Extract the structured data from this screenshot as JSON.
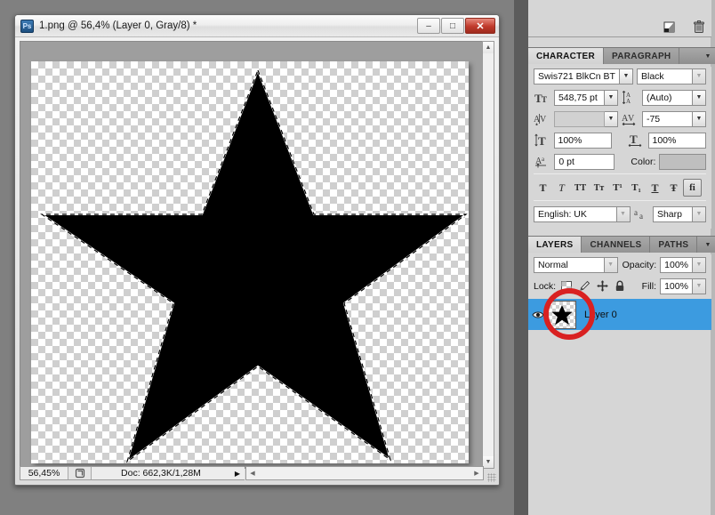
{
  "document_window": {
    "title": "1.png @ 56,4% (Layer 0, Gray/8) *",
    "app_icon": "Ps",
    "window_buttons": [
      {
        "name": "minimize",
        "glyph": "–"
      },
      {
        "name": "maximize",
        "glyph": "□"
      },
      {
        "name": "close",
        "glyph": "✕"
      }
    ],
    "status_bar": {
      "zoom": "56,45%",
      "doc_info": "Doc: 662,3K/1,28M",
      "preview_icon": "page-preview-icon",
      "expand_arrow": "▶"
    },
    "scrollbars": {
      "v_up": "▲",
      "v_down": "▼",
      "h_left": "◀",
      "h_right": "▶"
    }
  },
  "panel_toolstrip": {
    "new_layer_icon": "new-layer-icon",
    "delete_layer_icon": "trash-icon"
  },
  "character_panel": {
    "tabs": [
      {
        "label": "CHARACTER",
        "active": true
      },
      {
        "label": "PARAGRAPH",
        "active": false
      }
    ],
    "menu_arrow": "▼",
    "font_family": "Swis721 BlkCn BT",
    "font_style": "Black",
    "font_size_icon": "font-size-icon",
    "font_size": "548,75 pt",
    "leading_icon": "leading-icon",
    "leading": "(Auto)",
    "kerning_icon": "kerning-icon",
    "kerning": "",
    "tracking_icon": "tracking-icon",
    "tracking": "-75",
    "vertical_scale_icon": "vertical-scale-icon",
    "vertical_scale": "100%",
    "horizontal_scale_icon": "horizontal-scale-icon",
    "horizontal_scale": "100%",
    "baseline_icon": "baseline-shift-icon",
    "baseline_shift": "0 pt",
    "color_label": "Color:",
    "color_value": "#bfbfbf",
    "type_buttons": [
      {
        "name": "faux-bold",
        "glyph": "T"
      },
      {
        "name": "faux-italic",
        "glyph": "T"
      },
      {
        "name": "all-caps",
        "glyph": "TT"
      },
      {
        "name": "small-caps",
        "glyph": "Tт"
      },
      {
        "name": "superscript",
        "glyph": "T¹"
      },
      {
        "name": "subscript",
        "glyph": "T₁"
      },
      {
        "name": "underline",
        "glyph": "T"
      },
      {
        "name": "strikethrough",
        "glyph": "Ŧ"
      },
      {
        "name": "ligatures",
        "glyph": "fi"
      }
    ],
    "language": "English: UK",
    "antialias_icon": "antialias-icon",
    "antialias": "Sharp"
  },
  "layers_panel": {
    "tabs": [
      {
        "label": "LAYERS",
        "active": true
      },
      {
        "label": "CHANNELS",
        "active": false
      },
      {
        "label": "PATHS",
        "active": false
      }
    ],
    "menu_arrow": "▼",
    "blend_mode": "Normal",
    "opacity_label": "Opacity:",
    "opacity": "100%",
    "lock_label": "Lock:",
    "lock_icons": [
      {
        "name": "lock-transparency-icon"
      },
      {
        "name": "lock-image-pixels-icon",
        "glyph": "╱"
      },
      {
        "name": "lock-position-icon",
        "glyph": "✥"
      },
      {
        "name": "lock-all-icon",
        "glyph": "🔒"
      }
    ],
    "fill_label": "Fill:",
    "fill": "100%",
    "layers": [
      {
        "name": "Layer 0",
        "visible": true,
        "selected": true,
        "thumbnail": "star-thumbnail"
      }
    ]
  },
  "annotation": {
    "type": "red-circle-highlight",
    "color": "#d92121",
    "target": "layer-thumbnail"
  },
  "canvas": {
    "artwork": "black-five-pointed-star",
    "transparency_checker": true,
    "selection": "marching-ants-around-star",
    "colors": {
      "star_fill": "#000000",
      "checker_light": "#ffffff",
      "checker_dark": "#cfcfcf",
      "canvas_surround": "#9e9e9e"
    }
  }
}
